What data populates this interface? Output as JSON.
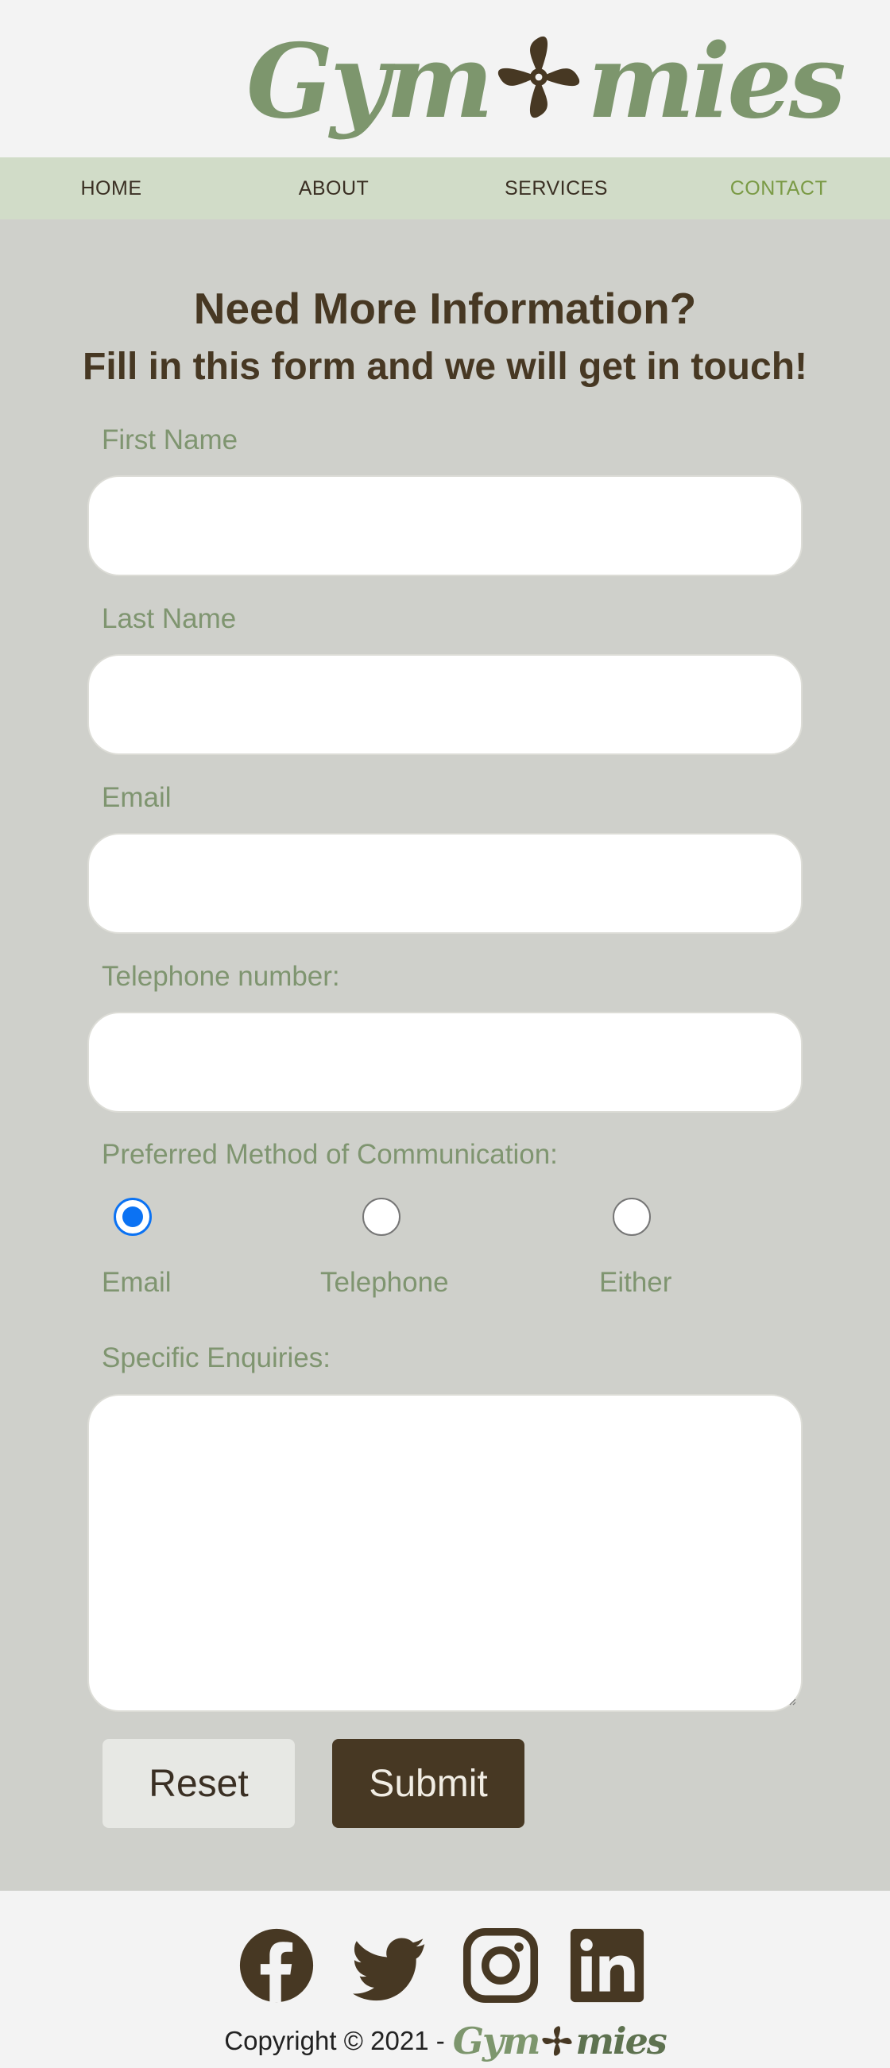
{
  "brand": {
    "name_left": "Gym",
    "name_right": "mies",
    "mark_color": "#473823",
    "accent_color": "#7d966d"
  },
  "nav": {
    "items": [
      {
        "label": "HOME"
      },
      {
        "label": "ABOUT"
      },
      {
        "label": "SERVICES"
      },
      {
        "label": "CONTACT",
        "active": true
      }
    ]
  },
  "form": {
    "title": "Need More Information?",
    "subtitle": "Fill in this form and we will get in touch!",
    "first_name_label": "First Name",
    "first_name_value": "",
    "last_name_label": "Last Name",
    "last_name_value": "",
    "email_label": "Email",
    "email_value": "",
    "phone_label": "Telephone number:",
    "phone_value": "",
    "method_label": "Preferred Method of Communication:",
    "methods": [
      {
        "label": "Email",
        "checked": true
      },
      {
        "label": "Telephone",
        "checked": false
      },
      {
        "label": "Either",
        "checked": false
      }
    ],
    "enquiries_label": "Specific Enquiries:",
    "enquiries_value": "",
    "reset_label": "Reset",
    "submit_label": "Submit"
  },
  "footer": {
    "social": [
      {
        "icon": "facebook-icon"
      },
      {
        "icon": "twitter-icon"
      },
      {
        "icon": "instagram-icon"
      },
      {
        "icon": "linkedin-icon"
      }
    ],
    "copyright": "Copyright © 2021 -",
    "logo_left": "Gym",
    "logo_right": "mies"
  }
}
